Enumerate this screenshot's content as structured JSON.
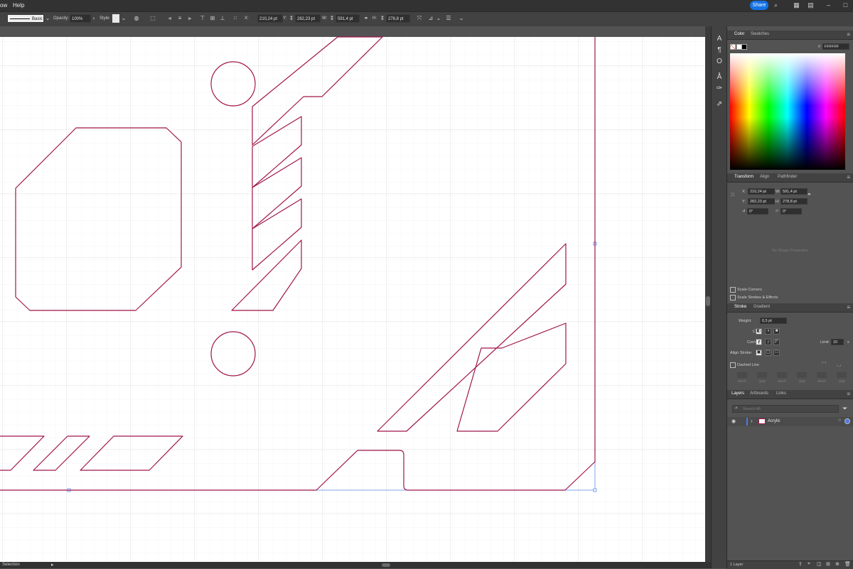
{
  "menu": {
    "items": [
      "ow",
      "Help"
    ]
  },
  "topbar": {
    "share_label": "Share"
  },
  "control": {
    "stroke_style": "Basic",
    "opacity_label": "Opacity:",
    "opacity_value": "100%",
    "style_label": "Style:",
    "x_label": "X:",
    "x_value": "210,24 pt",
    "y_label": "Y:",
    "y_value": "282,23 pt",
    "w_label": "W:",
    "w_value": "591,4 pt",
    "h_label": "H:",
    "h_value": "278,8 pt"
  },
  "status": {
    "tool": "Selection"
  },
  "color_panel": {
    "tabs": [
      "Color",
      "Swatches"
    ],
    "hex_label": "#",
    "hex_value": "FFFFFF"
  },
  "transform_panel": {
    "tabs": [
      "Transform",
      "Align",
      "Pathfinder"
    ],
    "x_label": "X:",
    "x_value": "210,24 pt",
    "y_label": "Y:",
    "y_value": "282,23 pt",
    "w_label": "W:",
    "w_value": "591,4 pt",
    "h_label": "H:",
    "h_value": "278,8 pt",
    "angle_value": "0°",
    "shear_value": "0°",
    "no_shape": "No Shape Properties",
    "scale_corners": "Scale Corners",
    "scale_strokes": "Scale Strokes & Effects"
  },
  "stroke_panel": {
    "tabs": [
      "Stroke",
      "Gradient"
    ],
    "weight_label": "Weight:",
    "weight_value": "0,5 pt",
    "cap_label": "Cap:",
    "corner_label": "Corner:",
    "limit_label": "Limit:",
    "limit_value": "10",
    "limit_unit": "x",
    "align_label": "Align Stroke:",
    "dashed_label": "Dashed Line",
    "dash_labels": [
      "dash",
      "gap",
      "dash",
      "gap",
      "dash",
      "gap"
    ]
  },
  "layers_panel": {
    "tabs": [
      "Layers",
      "Artboards",
      "Links"
    ],
    "search_placeholder": "Search All",
    "layers": [
      {
        "name": "Acrylic"
      }
    ],
    "footer": "1 Layer"
  },
  "colors": {
    "path": "#a0154a",
    "selection": "#4a7ff0",
    "grid": "#e3e3e3"
  }
}
